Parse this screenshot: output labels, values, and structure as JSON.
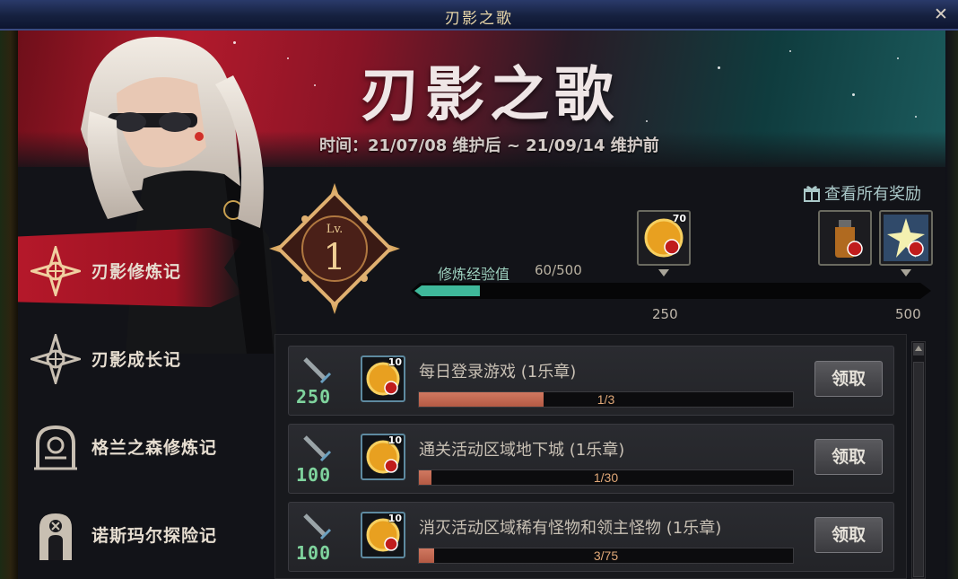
{
  "window": {
    "title": "刃影之歌",
    "close": "✕"
  },
  "banner": {
    "title": "刃影之歌",
    "date": "时间：21/07/08 维护后 ~ 21/09/14 维护前"
  },
  "nav": {
    "items": [
      {
        "label": "刃影修炼记",
        "icon": "compass-star-icon",
        "active": true
      },
      {
        "label": "刃影成长记",
        "icon": "compass-star-icon",
        "active": false
      },
      {
        "label": "格兰之森修炼记",
        "icon": "gate-arch-icon",
        "active": false
      },
      {
        "label": "诺斯玛尔探险记",
        "icon": "tombstone-icon",
        "active": false
      }
    ]
  },
  "level": {
    "prefix": "Lv.",
    "value": "1"
  },
  "rewards_link": {
    "label": "查看所有奖励",
    "icon": "gift-icon"
  },
  "progress": {
    "label": "修炼经验值",
    "value_text": "60/500",
    "fraction": 0.12,
    "ticks": [
      "250",
      "500"
    ],
    "milestones": [
      {
        "count": "70",
        "icon": "gold-coin-icon"
      },
      {
        "count": "",
        "icon": "potion-bottle-icon"
      },
      {
        "count": "",
        "icon": "burst-skill-icon"
      }
    ]
  },
  "tasks": [
    {
      "points": "250",
      "reward_count": "10",
      "name": "每日登录游戏 (1乐章)",
      "progress_text": "1/3",
      "fraction": 0.333,
      "button": "领取"
    },
    {
      "points": "100",
      "reward_count": "10",
      "name": "通关活动区域地下城 (1乐章)",
      "progress_text": "1/30",
      "fraction": 0.033,
      "button": "领取"
    },
    {
      "points": "100",
      "reward_count": "10",
      "name": "消灭活动区域稀有怪物和领主怪物 (1乐章)",
      "progress_text": "3/75",
      "fraction": 0.04,
      "button": "领取"
    }
  ],
  "colors": {
    "accent_red": "#b5182a",
    "accent_teal": "#3fb89a",
    "points_green": "#7fd39d",
    "bar_fill": "#c06a52"
  }
}
